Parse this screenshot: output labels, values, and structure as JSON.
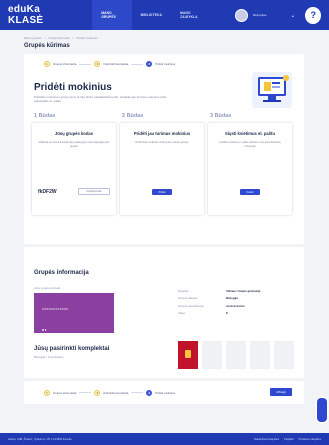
{
  "header": {
    "logo": "eduKa KLASĖ",
    "nav": [
      "MANO GRUPĖS",
      "BIBLIOTEKA",
      "MANO ZAIDYKLA"
    ],
    "user_name": "Mokytojas",
    "help": "?"
  },
  "breadcrumb": [
    "Mano grupės",
    "/",
    "Grupės kūrimas",
    "/",
    "Pridėti mokinius"
  ],
  "page_title": "Grupės kūrimas",
  "stepper": {
    "steps": [
      {
        "num": "1",
        "label": "Grupės informacija"
      },
      {
        "num": "2",
        "label": "Pasirinkti komplektą"
      },
      {
        "num": "3",
        "label": "Pridėti mokinius"
      }
    ]
  },
  "main": {
    "title": "Pridėti mokinius",
    "description": "Pridėkite mokinius į grupę vienu iš trijų būdų: pasidalinkite kodu, pridėkite jau turimus mokinius arba pakvieskite el. paštu",
    "options": [
      {
        "head": "1 Būdas",
        "title": "Jūsų grupės kodas",
        "desc": "Mokiniai turi įvesti šį kodą savo paskyroje, kad prisijungtų prie grupės",
        "code": "fkDF2W",
        "code_button": "Kopijuoti kodą"
      },
      {
        "head": "2 Būdas",
        "title": "Pridėti jau turimus mokinius",
        "desc": "Pasirinkite mokinius iš kitų jūsų sukurtų grupių",
        "button": "Pridėti"
      },
      {
        "head": "3 Būdas",
        "title": "Siųsti kvietimus el. paštu",
        "desc": "Įveskite mokinių el. pašto adresus ir jie gaus kvietimą prisijungti",
        "button": "Kviesti"
      }
    ]
  },
  "info": {
    "title": "Grupės informacija",
    "subtitle": "Jūsų grupės kortelė",
    "tile": {
      "name": "XXXXXXXXXXXX",
      "code": "M 8",
      "owner": "Klasė · Vilniaus Užupio gimnazija"
    },
    "props": [
      {
        "k": "Mokykla",
        "v": "Vilniaus Užupio gimnazija"
      },
      {
        "k": "Grupės dalykas",
        "v": "Biologija"
      },
      {
        "k": "Grupės pavadinimas",
        "v": "xxxxxxxxxxxx"
      },
      {
        "k": "Klasė",
        "v": "8"
      }
    ]
  },
  "bundle": {
    "title": "Jūsų pasirinkti komplektai",
    "subtitle": "Biologija / Komplektas"
  },
  "bottom": {
    "next_button": "Užbaigti"
  },
  "footer": {
    "left": "eduKa, UAB „Šviesa“, Vytauto pr. 25, LT-44352 Kaunas",
    "links": [
      "Naudojimosi taisyklės",
      "Pagalba",
      "Privatumo taisyklės"
    ]
  },
  "colors": {
    "brand": "#1f3ab3",
    "accent": "#2f48d0",
    "group_tile": "#8b3fa0",
    "book": "#c1132b"
  }
}
